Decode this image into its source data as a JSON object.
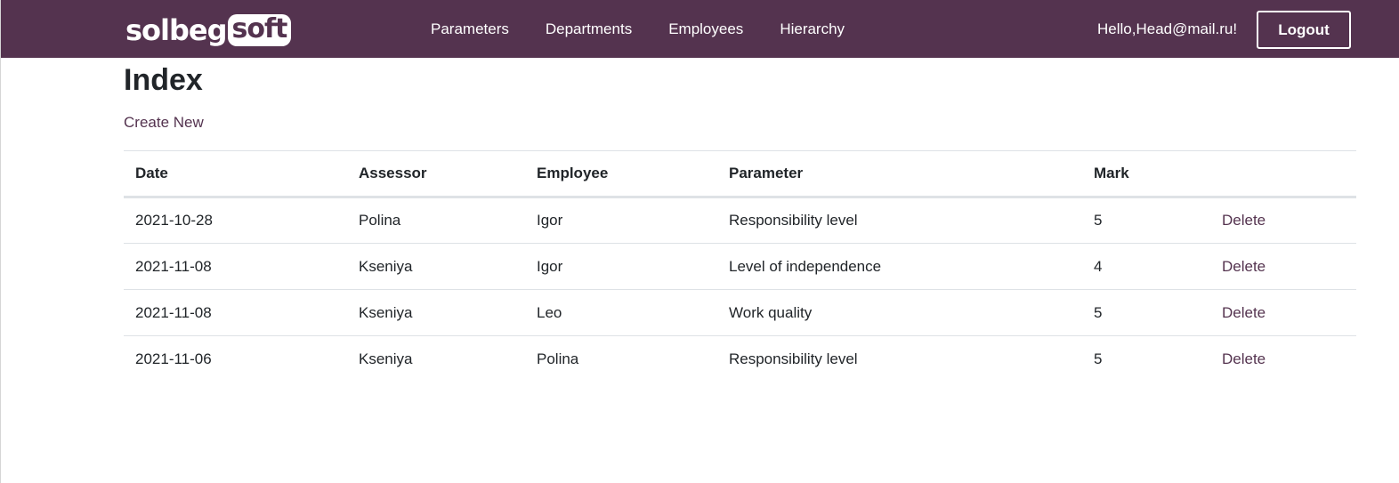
{
  "brand": {
    "left": "solbeg",
    "right": "soft"
  },
  "nav": {
    "items": [
      {
        "label": "Parameters"
      },
      {
        "label": "Departments"
      },
      {
        "label": "Employees"
      },
      {
        "label": "Hierarchy"
      }
    ],
    "greeting": "Hello,Head@mail.ru!",
    "logout_label": "Logout"
  },
  "page": {
    "title": "Index",
    "create_link": "Create New"
  },
  "table": {
    "headers": {
      "date": "Date",
      "assessor": "Assessor",
      "employee": "Employee",
      "parameter": "Parameter",
      "mark": "Mark"
    },
    "rows": [
      {
        "date": "2021-10-28",
        "assessor": "Polina",
        "employee": "Igor",
        "parameter": "Responsibility level",
        "mark": "5",
        "action": "Delete"
      },
      {
        "date": "2021-11-08",
        "assessor": "Kseniya",
        "employee": "Igor",
        "parameter": "Level of independence",
        "mark": "4",
        "action": "Delete"
      },
      {
        "date": "2021-11-08",
        "assessor": "Kseniya",
        "employee": "Leo",
        "parameter": "Work quality",
        "mark": "5",
        "action": "Delete"
      },
      {
        "date": "2021-11-06",
        "assessor": "Kseniya",
        "employee": "Polina",
        "parameter": "Responsibility level",
        "mark": "5",
        "action": "Delete"
      }
    ]
  },
  "colors": {
    "brand_primary": "#54334f",
    "border": "#dee2e6",
    "text": "#212529"
  }
}
